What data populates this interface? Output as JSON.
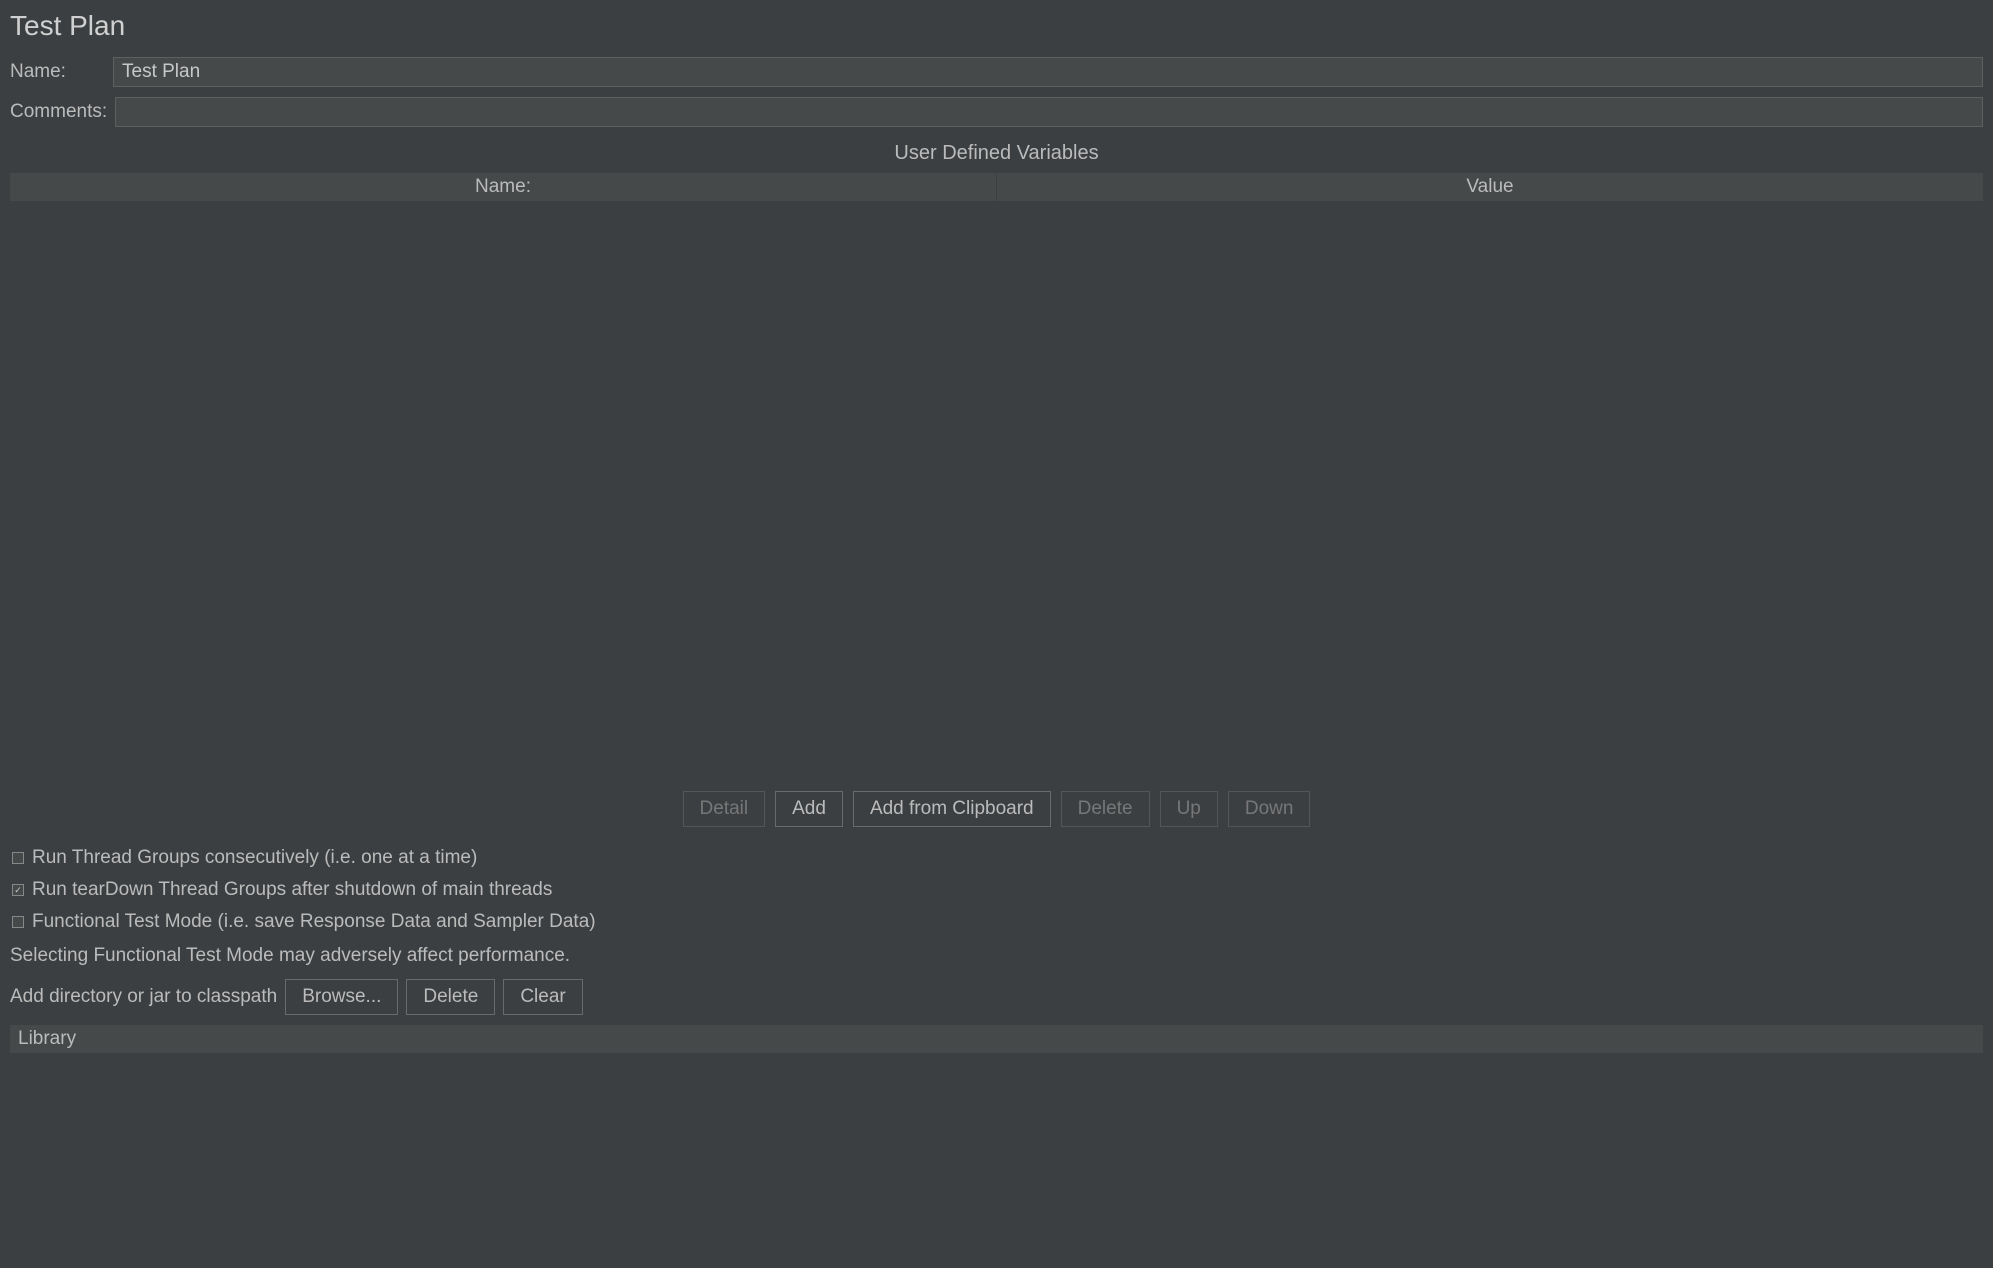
{
  "title": "Test Plan",
  "form": {
    "name_label": "Name:",
    "name_value": "Test Plan",
    "comments_label": "Comments:",
    "comments_value": ""
  },
  "variables": {
    "section_title": "User Defined Variables",
    "columns": {
      "name": "Name:",
      "value": "Value"
    },
    "buttons": {
      "detail": "Detail",
      "add": "Add",
      "add_from_clipboard": "Add from Clipboard",
      "delete": "Delete",
      "up": "Up",
      "down": "Down"
    }
  },
  "options": {
    "run_consecutively": {
      "label": "Run Thread Groups consecutively (i.e. one at a time)",
      "checked": false
    },
    "teardown": {
      "label": "Run tearDown Thread Groups after shutdown of main threads",
      "checked": true
    },
    "functional_mode": {
      "label": "Functional Test Mode (i.e. save Response Data and Sampler Data)",
      "checked": false
    },
    "functional_note": "Selecting Functional Test Mode may adversely affect performance."
  },
  "classpath": {
    "label": "Add directory or jar to classpath",
    "buttons": {
      "browse": "Browse...",
      "delete": "Delete",
      "clear": "Clear"
    },
    "library_header": "Library"
  }
}
